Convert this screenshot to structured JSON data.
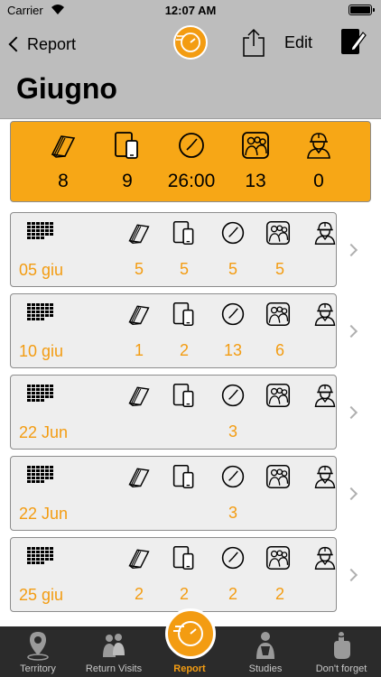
{
  "status": {
    "carrier": "Carrier",
    "time": "12:07 AM"
  },
  "nav": {
    "back_label": "Report",
    "edit_label": "Edit",
    "title": "Giugno"
  },
  "summary": {
    "placements": "8",
    "videos": "9",
    "hours": "26:00",
    "return_visits": "13",
    "studies": "0"
  },
  "rows": [
    {
      "date": "05 giu",
      "placements": "5",
      "videos": "5",
      "hours": "5",
      "return_visits": "5",
      "studies": ""
    },
    {
      "date": "10 giu",
      "placements": "1",
      "videos": "2",
      "hours": "13",
      "return_visits": "6",
      "studies": ""
    },
    {
      "date": "22 Jun",
      "placements": "",
      "videos": "",
      "hours": "3",
      "return_visits": "",
      "studies": ""
    },
    {
      "date": "22 Jun",
      "placements": "",
      "videos": "",
      "hours": "3",
      "return_visits": "",
      "studies": ""
    },
    {
      "date": "25 giu",
      "placements": "2",
      "videos": "2",
      "hours": "2",
      "return_visits": "2",
      "studies": ""
    }
  ],
  "tabs": [
    {
      "label": "Territory",
      "icon": "map-pin-icon"
    },
    {
      "label": "Return Visits",
      "icon": "people-icon"
    },
    {
      "label": "Report",
      "icon": "report-icon"
    },
    {
      "label": "Studies",
      "icon": "study-icon"
    },
    {
      "label": "Don't forget",
      "icon": "reminder-finger-icon"
    }
  ],
  "colors": {
    "accent": "#f39c12",
    "summary_bg": "#f7a716",
    "bar_bg": "#bdbdbd",
    "tab_bg": "#2b2b2b"
  }
}
